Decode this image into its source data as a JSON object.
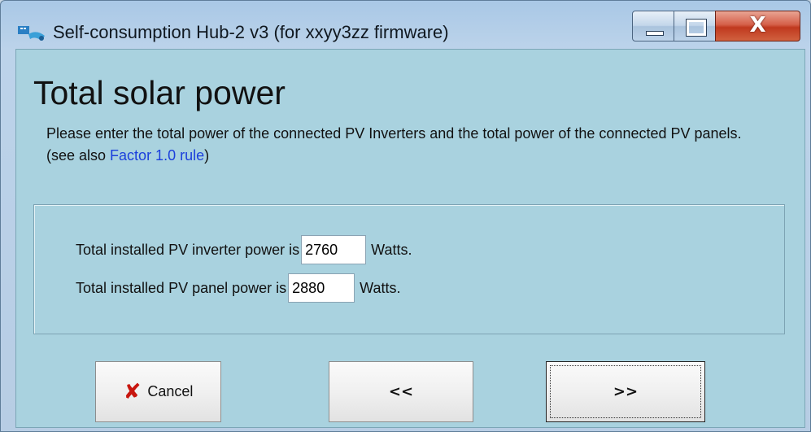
{
  "window": {
    "title": "Self-consumption Hub-2 v3 (for xxyy3zz firmware)",
    "close_glyph": "X"
  },
  "page": {
    "heading": "Total solar power",
    "description": "Please enter the total power of the connected PV Inverters and the total power of the connected PV panels.",
    "see_also_prefix": "(see also ",
    "see_also_link": "Factor 1.0 rule",
    "see_also_suffix": ")"
  },
  "form": {
    "inverter_label": "Total installed PV inverter power is",
    "inverter_value": "2760",
    "inverter_unit": "Watts.",
    "panel_label": "Total installed PV panel power is",
    "panel_value": "2880",
    "panel_unit": "Watts."
  },
  "buttons": {
    "cancel_label": "Cancel",
    "prev_label": "<<",
    "next_label": ">>"
  },
  "colors": {
    "client_bg": "#a9d2df",
    "link": "#1b3fdc",
    "cancel_icon": "#c8160f",
    "close_button": "#c0391f"
  },
  "icons": {
    "app": "app-logo-icon",
    "cancel": "red-x-icon"
  }
}
